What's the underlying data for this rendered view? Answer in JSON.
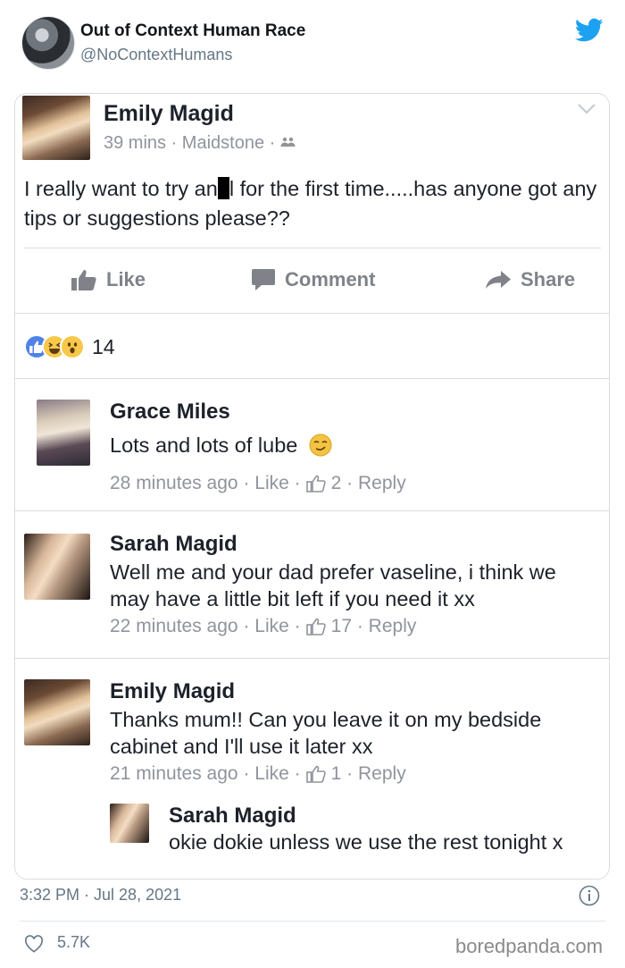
{
  "tweet": {
    "author_name": "Out of Context Human Race",
    "author_handle": "@NoContextHumans",
    "time": "3:32 PM · Jul 28, 2021",
    "likes": "5.7K"
  },
  "post": {
    "author": "Emily Magid",
    "meta": "39 mins · Maidstone · ",
    "text_before": "I really want to try an",
    "text_after": "l for the first time.....has anyone got any tips or suggestions please??",
    "actions": {
      "like": "Like",
      "comment": "Comment",
      "share": "Share"
    },
    "reaction_count": "14"
  },
  "comments": [
    {
      "name": "Grace Miles",
      "text": "Lots and lots of lube",
      "time": "28 minutes ago",
      "like": "Like",
      "likes": "2",
      "reply": "Reply"
    },
    {
      "name": "Sarah Magid",
      "text": "Well me and your dad prefer vaseline, i think we may have a little bit left if you need it xx",
      "time": "22 minutes ago",
      "like": "Like",
      "likes": "17",
      "reply": "Reply"
    },
    {
      "name": "Emily Magid",
      "text": "Thanks mum!! Can you leave it on my bedside cabinet and I'll use it later xx",
      "time": "21 minutes ago",
      "like": "Like",
      "likes": "1",
      "reply": "Reply"
    },
    {
      "name": "Sarah Magid",
      "text": "okie dokie unless we use the rest tonight x"
    }
  ],
  "watermark": "boredpanda.com",
  "colors": {
    "twitter_blue": "#1da1f2",
    "fb_grey": "#90949c",
    "fb_like_blue": "#4f82e8"
  }
}
